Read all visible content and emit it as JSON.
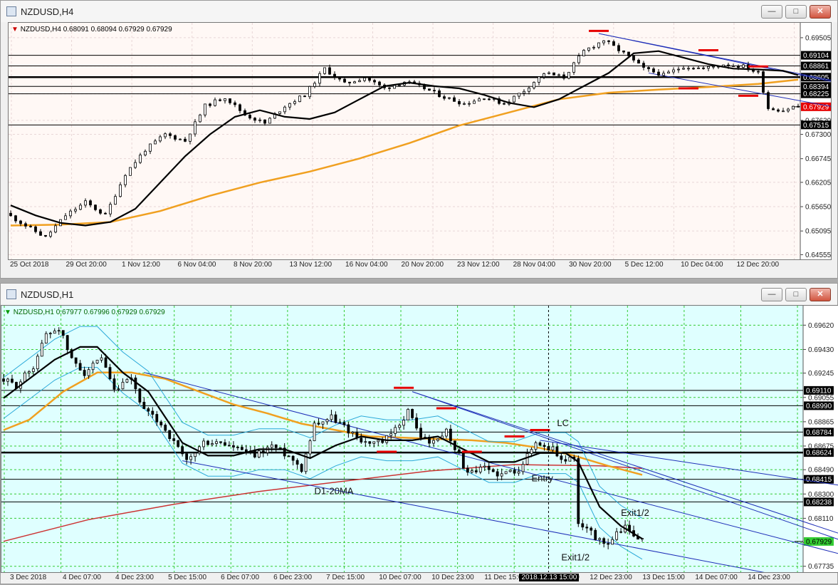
{
  "windows": [
    {
      "title": "NZDUSD,H4",
      "info": {
        "symbol": "NZDUSD,H4",
        "ohlc": "0.68091 0.68094 0.67929 0.67929"
      },
      "bg": "#FFF8F5",
      "grid": "#E8D6D6",
      "accent": "#CC0000",
      "chart_data": {
        "type": "candlestick",
        "ylim": [
          0.6448,
          0.6978
        ],
        "y_ticks": [
          "0.69505",
          "0.68860",
          "0.68225",
          "0.67620",
          "0.67300",
          "0.66745",
          "0.66205",
          "0.65650",
          "0.65095",
          "0.64555"
        ],
        "x_ticks": [
          "25 Oct 2018",
          "29 Oct 20:00",
          "1 Nov 12:00",
          "6 Nov 04:00",
          "8 Nov 20:00",
          "13 Nov 12:00",
          "16 Nov 04:00",
          "20 Nov 20:00",
          "23 Nov 12:00",
          "28 Nov 04:00",
          "30 Nov 20:00",
          "5 Dec 12:00",
          "10 Dec 04:00",
          "12 Dec 20:00"
        ],
        "price_levels": [
          {
            "value": 0.69104,
            "label": "0.69104",
            "style": "line"
          },
          {
            "value": 0.68861,
            "label": "0.68861",
            "style": "line"
          },
          {
            "value": 0.68605,
            "label": "0.68605",
            "style": "thick"
          },
          {
            "value": 0.68394,
            "label": "0.68394",
            "style": "line"
          },
          {
            "value": 0.68225,
            "label": "0.68225",
            "style": "line"
          },
          {
            "value": 0.67929,
            "label": "0.67929",
            "style": "current"
          },
          {
            "value": 0.67515,
            "label": "0.67515",
            "style": "line"
          }
        ],
        "ma_black": [
          [
            0,
            0.6568
          ],
          [
            5,
            0.6545
          ],
          [
            10,
            0.6528
          ],
          [
            15,
            0.6522
          ],
          [
            20,
            0.653
          ],
          [
            25,
            0.656
          ],
          [
            30,
            0.662
          ],
          [
            35,
            0.668
          ],
          [
            40,
            0.673
          ],
          [
            45,
            0.677
          ],
          [
            50,
            0.6785
          ],
          [
            55,
            0.677
          ],
          [
            60,
            0.6765
          ],
          [
            65,
            0.678
          ],
          [
            70,
            0.681
          ],
          [
            75,
            0.684
          ],
          [
            80,
            0.6848
          ],
          [
            85,
            0.684
          ],
          [
            90,
            0.6835
          ],
          [
            95,
            0.682
          ],
          [
            100,
            0.6802
          ],
          [
            105,
            0.6792
          ],
          [
            110,
            0.681
          ],
          [
            115,
            0.684
          ],
          [
            120,
            0.687
          ],
          [
            125,
            0.6915
          ],
          [
            130,
            0.692
          ],
          [
            135,
            0.6905
          ],
          [
            140,
            0.689
          ],
          [
            145,
            0.688
          ],
          [
            150,
            0.6878
          ],
          [
            155,
            0.6875
          ],
          [
            158,
            0.6865
          ]
        ],
        "ma_orange": [
          [
            0,
            0.6522
          ],
          [
            10,
            0.6524
          ],
          [
            20,
            0.653
          ],
          [
            30,
            0.6555
          ],
          [
            40,
            0.659
          ],
          [
            50,
            0.662
          ],
          [
            60,
            0.6645
          ],
          [
            70,
            0.6675
          ],
          [
            80,
            0.671
          ],
          [
            90,
            0.675
          ],
          [
            100,
            0.678
          ],
          [
            110,
            0.681
          ],
          [
            120,
            0.6825
          ],
          [
            130,
            0.6832
          ],
          [
            140,
            0.6838
          ],
          [
            150,
            0.6845
          ],
          [
            158,
            0.6855
          ]
        ],
        "anchors": [
          [
            0,
            0.655
          ],
          [
            5,
            0.6515
          ],
          [
            8,
            0.6495
          ],
          [
            12,
            0.6545
          ],
          [
            16,
            0.6575
          ],
          [
            20,
            0.6545
          ],
          [
            24,
            0.664
          ],
          [
            28,
            0.6695
          ],
          [
            32,
            0.673
          ],
          [
            36,
            0.6715
          ],
          [
            40,
            0.6795
          ],
          [
            44,
            0.6815
          ],
          [
            48,
            0.6775
          ],
          [
            52,
            0.6755
          ],
          [
            56,
            0.6795
          ],
          [
            60,
            0.682
          ],
          [
            64,
            0.688
          ],
          [
            68,
            0.6845
          ],
          [
            72,
            0.686
          ],
          [
            76,
            0.6835
          ],
          [
            80,
            0.685
          ],
          [
            84,
            0.6835
          ],
          [
            88,
            0.6815
          ],
          [
            92,
            0.68
          ],
          [
            96,
            0.6815
          ],
          [
            100,
            0.68
          ],
          [
            104,
            0.683
          ],
          [
            108,
            0.687
          ],
          [
            112,
            0.686
          ],
          [
            116,
            0.692
          ],
          [
            120,
            0.6945
          ],
          [
            124,
            0.6915
          ],
          [
            128,
            0.688
          ],
          [
            132,
            0.6865
          ],
          [
            136,
            0.6885
          ],
          [
            140,
            0.688
          ],
          [
            144,
            0.689
          ],
          [
            148,
            0.6885
          ],
          [
            151,
            0.687
          ],
          [
            153,
            0.679
          ],
          [
            156,
            0.6785
          ],
          [
            158,
            0.6793
          ]
        ],
        "n_candles": 159,
        "lines": [
          {
            "from": [
              118,
              0.696
            ],
            "to": [
              200,
              0.6768
            ],
            "color": "#1E2EB8"
          },
          {
            "from": [
              118,
              0.696
            ],
            "to": [
              200,
              0.6773
            ],
            "color": "#1E2EB8"
          },
          {
            "from": [
              128,
              0.687
            ],
            "to": [
              200,
              0.672
            ],
            "color": "#1E2EB8"
          }
        ],
        "marks": [
          [
            118,
            0.6966
          ],
          [
            140,
            0.6922
          ],
          [
            136,
            0.6835
          ],
          [
            150,
            0.6885
          ],
          [
            148,
            0.6818
          ]
        ]
      }
    },
    {
      "title": "NZDUSD,H1",
      "info": {
        "symbol": "NZDUSD,H1",
        "ohlc": "0.67977 0.67996 0.67929 0.67929"
      },
      "bg": "#DFFFFF",
      "grid": "#33CC33",
      "accent": "#009900",
      "chart_data": {
        "type": "candlestick",
        "ylim": [
          0.677,
          0.6975
        ],
        "y_ticks": [
          "0.69620",
          "0.69430",
          "0.69245",
          "0.69055",
          "0.68865",
          "0.68675",
          "0.68490",
          "0.68300",
          "0.68110",
          "0.67920",
          "0.67735"
        ],
        "x_ticks": [
          "3 Dec 2018",
          "4 Dec 07:00",
          "4 Dec 23:00",
          "5 Dec 15:00",
          "6 Dec 07:00",
          "6 Dec 23:00",
          "7 Dec 15:00",
          "10 Dec 07:00",
          "10 Dec 23:00",
          "11 Dec 15:00",
          "12 Dec 07:00",
          "12 Dec 23:00",
          "13 Dec 15:00",
          "14 Dec 07:00",
          "14 Dec 23:00"
        ],
        "cursor_label": "2018.12.13 15:00",
        "price_levels": [
          {
            "value": 0.6911,
            "label": "0.69110",
            "style": "line"
          },
          {
            "value": 0.6899,
            "label": "0.68990",
            "style": "line"
          },
          {
            "value": 0.68784,
            "label": "0.68784",
            "style": "line"
          },
          {
            "value": 0.68624,
            "label": "0.68624",
            "style": "thick"
          },
          {
            "value": 0.68415,
            "label": "0.68415",
            "style": "line"
          },
          {
            "value": 0.68238,
            "label": "0.68238",
            "style": "line"
          },
          {
            "value": 0.67929,
            "label": "0.67929",
            "style": "current"
          }
        ],
        "annotations": [
          {
            "text": "LC",
            "at": [
              130,
              0.6883
            ]
          },
          {
            "text": "Entry",
            "at": [
              124,
              0.684
            ]
          },
          {
            "text": "D1-20MA",
            "at": [
              73,
              0.683
            ]
          },
          {
            "text": "Exit1/2",
            "at": [
              145,
              0.6813
            ]
          },
          {
            "text": "Exit1/2",
            "at": [
              131,
              0.6778
            ]
          }
        ],
        "anchors": [
          [
            0,
            0.692
          ],
          [
            4,
            0.6915
          ],
          [
            8,
            0.693
          ],
          [
            11,
            0.6955
          ],
          [
            14,
            0.696
          ],
          [
            17,
            0.6935
          ],
          [
            20,
            0.6925
          ],
          [
            24,
            0.6935
          ],
          [
            27,
            0.691
          ],
          [
            31,
            0.692
          ],
          [
            34,
            0.6895
          ],
          [
            38,
            0.6885
          ],
          [
            42,
            0.6865
          ],
          [
            44,
            0.6855
          ],
          [
            48,
            0.687
          ],
          [
            52,
            0.687
          ],
          [
            56,
            0.6865
          ],
          [
            60,
            0.686
          ],
          [
            64,
            0.6868
          ],
          [
            68,
            0.686
          ],
          [
            71,
            0.685
          ],
          [
            74,
            0.6885
          ],
          [
            78,
            0.689
          ],
          [
            82,
            0.688
          ],
          [
            86,
            0.687
          ],
          [
            90,
            0.687
          ],
          [
            93,
            0.688
          ],
          [
            96,
            0.6895
          ],
          [
            99,
            0.6875
          ],
          [
            102,
            0.687
          ],
          [
            105,
            0.688
          ],
          [
            108,
            0.686
          ],
          [
            110,
            0.6845
          ],
          [
            114,
            0.685
          ],
          [
            118,
            0.6845
          ],
          [
            122,
            0.685
          ],
          [
            126,
            0.687
          ],
          [
            130,
            0.6865
          ],
          [
            133,
            0.6855
          ],
          [
            135,
            0.686
          ],
          [
            136,
            0.6805
          ],
          [
            139,
            0.68
          ],
          [
            142,
            0.679
          ],
          [
            144,
            0.6795
          ],
          [
            147,
            0.6805
          ],
          [
            150,
            0.6793
          ]
        ],
        "n_candles": 151,
        "ma_black": [
          [
            0,
            0.6905
          ],
          [
            6,
            0.692
          ],
          [
            12,
            0.6935
          ],
          [
            18,
            0.6945
          ],
          [
            22,
            0.6945
          ],
          [
            28,
            0.6925
          ],
          [
            34,
            0.691
          ],
          [
            38,
            0.689
          ],
          [
            42,
            0.687
          ],
          [
            48,
            0.686
          ],
          [
            54,
            0.686
          ],
          [
            60,
            0.6865
          ],
          [
            66,
            0.6865
          ],
          [
            72,
            0.6858
          ],
          [
            78,
            0.6868
          ],
          [
            84,
            0.6875
          ],
          [
            90,
            0.6872
          ],
          [
            96,
            0.6872
          ],
          [
            102,
            0.6875
          ],
          [
            108,
            0.6865
          ],
          [
            114,
            0.6855
          ],
          [
            120,
            0.6855
          ],
          [
            126,
            0.6862
          ],
          [
            132,
            0.6862
          ],
          [
            135,
            0.6855
          ],
          [
            140,
            0.682
          ],
          [
            145,
            0.6805
          ],
          [
            150,
            0.6795
          ]
        ],
        "ma_orange": [
          [
            0,
            0.688
          ],
          [
            6,
            0.6888
          ],
          [
            14,
            0.691
          ],
          [
            22,
            0.6925
          ],
          [
            30,
            0.6925
          ],
          [
            38,
            0.692
          ],
          [
            46,
            0.691
          ],
          [
            54,
            0.69
          ],
          [
            62,
            0.6893
          ],
          [
            70,
            0.6885
          ],
          [
            78,
            0.688
          ],
          [
            86,
            0.6875
          ],
          [
            94,
            0.6874
          ],
          [
            102,
            0.6873
          ],
          [
            110,
            0.6872
          ],
          [
            118,
            0.687
          ],
          [
            126,
            0.6866
          ],
          [
            134,
            0.686
          ],
          [
            142,
            0.6852
          ],
          [
            150,
            0.6845
          ]
        ],
        "ma_red": [
          [
            0,
            0.6793
          ],
          [
            20,
            0.681
          ],
          [
            40,
            0.6822
          ],
          [
            60,
            0.6832
          ],
          [
            80,
            0.684
          ],
          [
            100,
            0.6848
          ],
          [
            120,
            0.6853
          ],
          [
            140,
            0.6852
          ],
          [
            150,
            0.685
          ]
        ],
        "lines": [
          {
            "from": [
              33,
              0.6925
            ],
            "to": [
              200,
              0.678
            ],
            "color": "#1E2EB8"
          },
          {
            "from": [
              42,
              0.6856
            ],
            "to": [
              200,
              0.6755
            ],
            "color": "#1E2EB8"
          },
          {
            "from": [
              96,
              0.691
            ],
            "to": [
              200,
              0.679
            ],
            "color": "#1E2EB8"
          },
          {
            "from": [
              96,
              0.691
            ],
            "to": [
              200,
              0.6795
            ],
            "color": "#1E2EB8"
          },
          {
            "from": [
              126,
              0.6872
            ],
            "to": [
              200,
              0.6835
            ],
            "color": "#1E2EB8"
          }
        ],
        "marks": [
          [
            94,
            0.6913
          ],
          [
            104,
            0.6897
          ],
          [
            110,
            0.6863
          ],
          [
            120,
            0.6875
          ],
          [
            126,
            0.688
          ],
          [
            90,
            0.6863
          ]
        ]
      }
    }
  ]
}
